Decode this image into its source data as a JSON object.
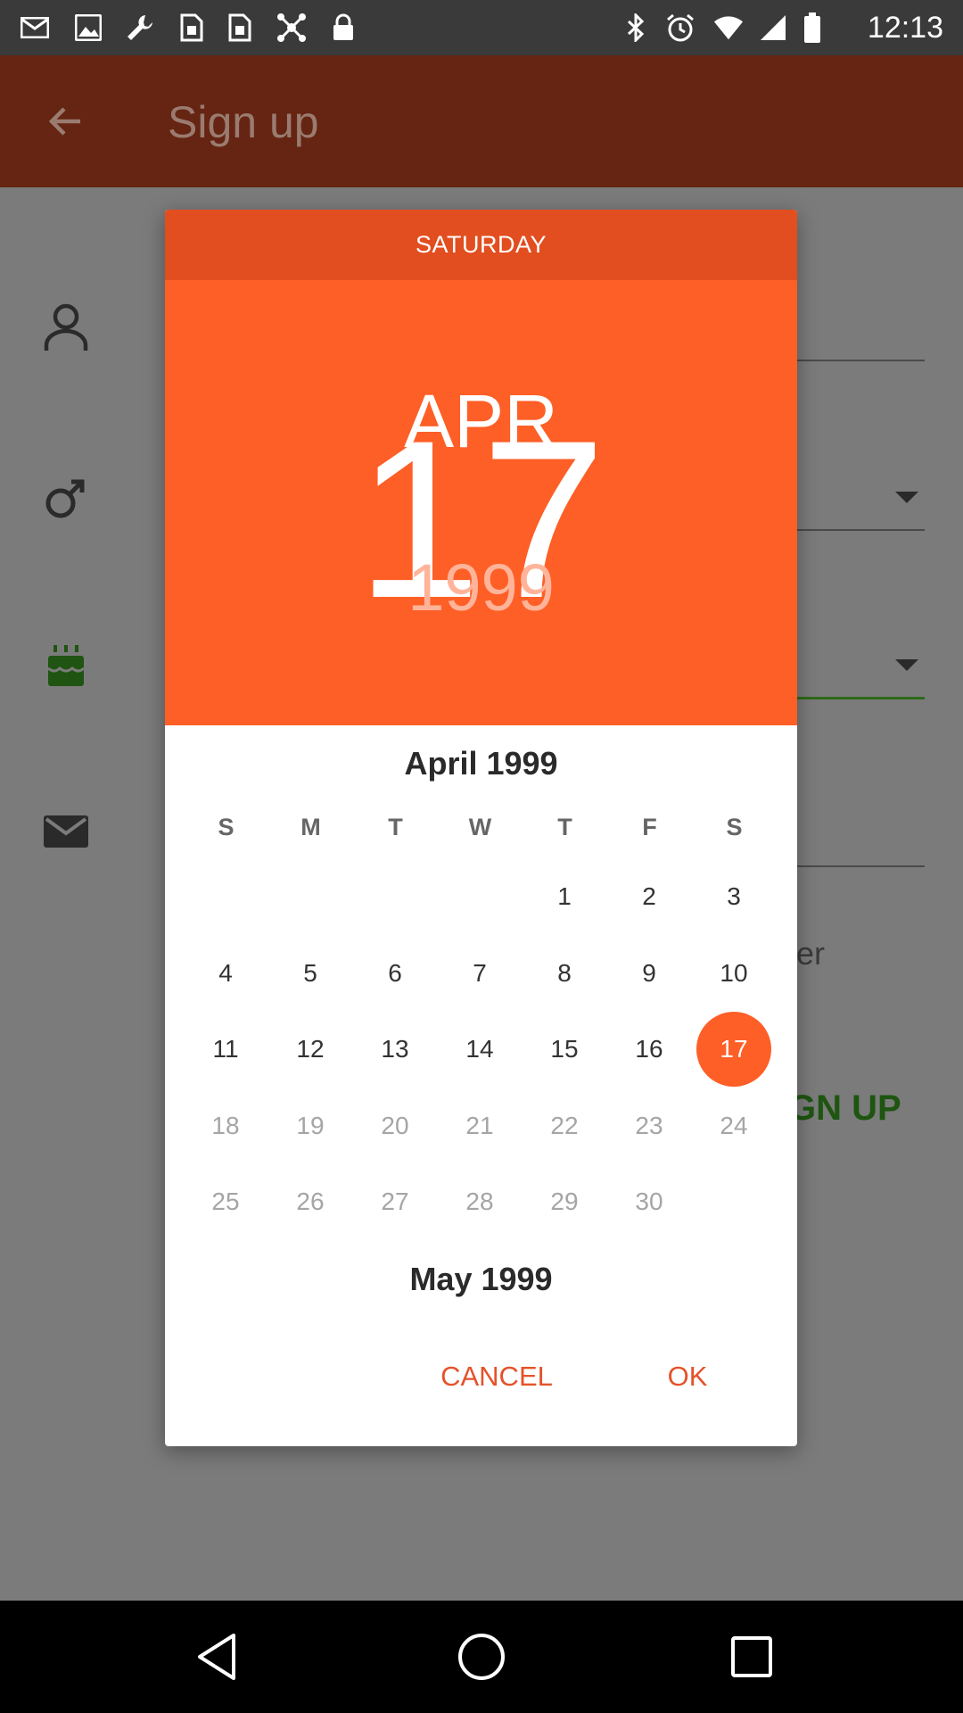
{
  "status_bar": {
    "time": "12:13",
    "left_icons": [
      "mail-icon",
      "image-icon",
      "wrench-icon",
      "sim-icon",
      "sim-icon",
      "drone-icon",
      "lock-icon"
    ],
    "right_icons": [
      "bluetooth-icon",
      "alarm-icon",
      "wifi-icon",
      "signal-icon",
      "battery-icon"
    ]
  },
  "app_bar": {
    "title": "Sign up",
    "back_icon": "arrow-back-icon"
  },
  "background_form": {
    "icons": [
      "person-icon",
      "gender-icon",
      "cake-icon",
      "mail-icon"
    ],
    "visible_fragment_text": "er",
    "signup_fragment": "GN UP"
  },
  "date_picker": {
    "day_of_week": "SATURDAY",
    "month_short": "APR",
    "day": "17",
    "year": "1999",
    "month_title": "April 1999",
    "next_month_title": "May 1999",
    "weekday_headers": [
      "S",
      "M",
      "T",
      "W",
      "T",
      "F",
      "S"
    ],
    "selected_day": 17,
    "days": [
      "1",
      "2",
      "3",
      "4",
      "5",
      "6",
      "7",
      "8",
      "9",
      "10",
      "11",
      "12",
      "13",
      "14",
      "15",
      "16",
      "17",
      "18",
      "19",
      "20",
      "21",
      "22",
      "23",
      "24",
      "25",
      "26",
      "27",
      "28",
      "29",
      "30"
    ],
    "first_weekday_index": 4,
    "last_enabled_day": 17,
    "accent_color": "#fe5f27",
    "cancel_label": "CANCEL",
    "ok_label": "OK"
  },
  "nav_bar": {
    "icons": [
      "back-triangle-icon",
      "home-circle-icon",
      "recents-square-icon"
    ]
  }
}
